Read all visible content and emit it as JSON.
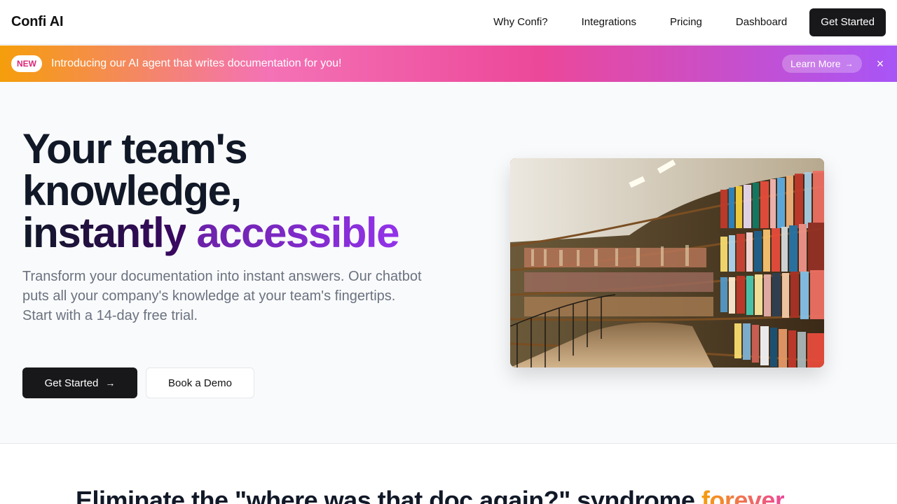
{
  "nav": {
    "logo": "Confi AI",
    "links": [
      "Why Confi?",
      "Integrations",
      "Pricing",
      "Dashboard"
    ],
    "cta": "Get Started"
  },
  "banner": {
    "badge": "NEW",
    "text": "Introducing our AI agent that writes documentation for you!",
    "learn_more": "Learn More",
    "close": "×"
  },
  "hero": {
    "title_line1": "Your team's",
    "title_line2": "knowledge,",
    "title_line3a": "instantly",
    "title_line3b": "accessible",
    "subtitle_line1": "Transform your documentation into instant answers. Our chatbot puts all your company's knowledge at your team's fingertips.",
    "subtitle_line2": "Start with a 14-day free trial.",
    "primary_button": "Get Started",
    "secondary_button": "Book a Demo"
  },
  "section": {
    "heading_main": "Eliminate the \"where was that doc again?\" syndrome",
    "heading_accent": "forever"
  },
  "icons": {
    "arrow": "→",
    "close": "×"
  },
  "colors": {
    "brand_dark": "#18181b",
    "accent_purple": "#9333ea",
    "banner_start": "#f59e0b",
    "banner_mid": "#ec4899",
    "banner_end": "#a855f7"
  }
}
